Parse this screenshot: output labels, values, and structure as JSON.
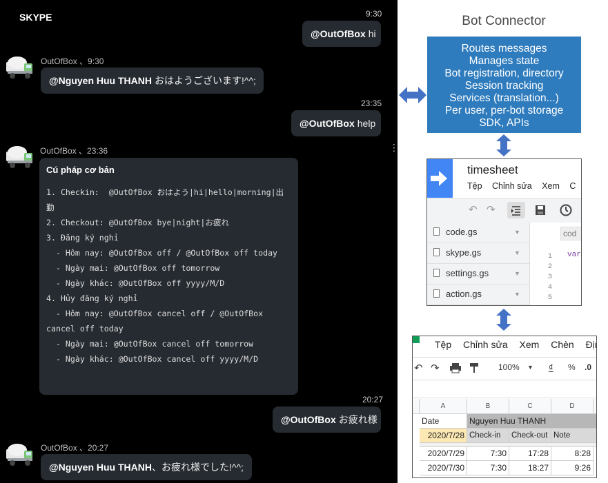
{
  "skype": {
    "title": "SKYPE",
    "messages": [
      {
        "time": "9:30",
        "mention": "@OutOfBox",
        "text": "hi"
      },
      {
        "sender": "OutOfBox 、9:30",
        "mention": "@Nguyen Huu THANH",
        "text": "おはようございます!^^;"
      },
      {
        "time": "23:35",
        "mention": "@OutOfBox",
        "text": "help"
      },
      {
        "sender": "OutOfBox 、23:36"
      },
      {
        "time": "20:27",
        "mention": "@OutOfBox",
        "text": "お疲れ様"
      },
      {
        "sender": "OutOfBox 、20:27",
        "mention": "@Nguyen Huu THANH",
        "text": "、お疲れ様でした!^^;"
      }
    ],
    "help": {
      "title": "Cú pháp cơ bản",
      "lines": [
        "1. Checkin:  @OutOfBox おはよう|hi|hello|morning|出",
        "勤",
        "2. Checkout: @OutOfBox bye|night|お疲れ",
        "3. Đăng ký nghỉ",
        "  - Hôm nay: @OutOfBox off / @OutOfBox off today",
        "  - Ngày mai: @OutOfBox off tomorrow",
        "  - Ngày khác: @OutOfBox off yyyy/M/D",
        "4. Hủy đăng ký nghỉ",
        "  - Hôm nay: @OutOfBox cancel off / @OutOfBox",
        "cancel off today",
        "  - Ngày mai: @OutOfBox cancel off tomorrow",
        "  - Ngày khác: @OutOfBox cancel off yyyy/M/D"
      ]
    }
  },
  "bot_connector": {
    "title": "Bot Connector",
    "lines": [
      "Routes messages",
      "Manages state",
      "Bot registration, directory",
      "Session tracking",
      "Services (translation...)",
      "Per user, per-bot storage",
      "SDK, APIs"
    ],
    "box_color": "#2e7bbd",
    "arrow_color": "#4472c4"
  },
  "editor": {
    "title": "timesheet",
    "menu": [
      "Tệp",
      "Chỉnh sửa",
      "Xem",
      "C"
    ],
    "files": [
      "code.gs",
      "skype.gs",
      "settings.gs",
      "action.gs"
    ],
    "code_tab": "cod",
    "line_numbers": [
      "1",
      "2",
      "3",
      "4",
      "5"
    ],
    "code_first": "var"
  },
  "sheet": {
    "menu": [
      "Tệp",
      "Chỉnh sửa",
      "Xem",
      "Chèn",
      "Định"
    ],
    "zoom": "100%",
    "currency": "₫",
    "percent": "%",
    "decimal": ".0",
    "columns": [
      "A",
      "B",
      "C",
      "D"
    ],
    "rows": [
      [
        "Date",
        "Nguyen Huu THANH",
        "",
        ""
      ],
      [
        "2020/7/28",
        "Check-in",
        "Check-out",
        "Note"
      ],
      [
        "2020/7/29",
        "7:30",
        "17:28",
        "8:28"
      ],
      [
        "2020/7/30",
        "7:30",
        "18:27",
        "9:26"
      ]
    ]
  }
}
